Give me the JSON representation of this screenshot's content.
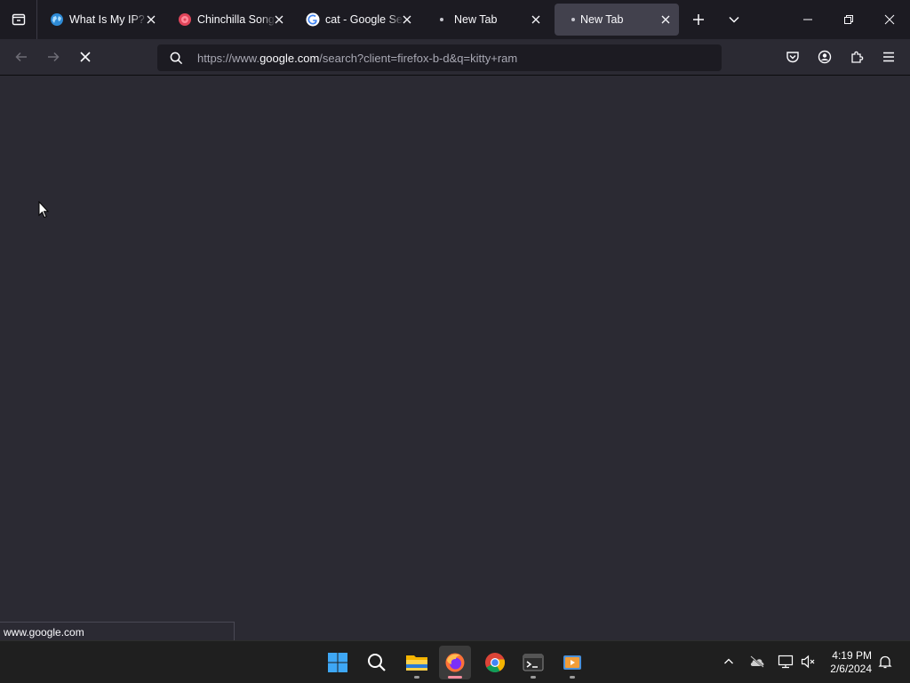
{
  "tabs": [
    {
      "title": "What Is My IP? Best",
      "favicon": "globe-icon",
      "active": false
    },
    {
      "title": "Chinchilla Songs",
      "favicon": "music-icon",
      "active": false
    },
    {
      "title": "cat - Google Search",
      "favicon": "google-icon",
      "active": false
    },
    {
      "title": "New Tab",
      "favicon": "loading-dot-icon",
      "active": false
    },
    {
      "title": "New Tab",
      "favicon": "loading-dot-icon",
      "active": true
    }
  ],
  "navbar": {
    "url_prefix": "https://www.",
    "url_host": "google.com",
    "url_suffix": "/search?client=firefox-b-d&q=kitty+ram"
  },
  "status": {
    "link": "www.google.com"
  },
  "clock": {
    "time": "4:19 PM",
    "date": "2/6/2024"
  },
  "colors": {
    "background": "#2b2a33",
    "tabbar": "#1c1b22",
    "active_tab": "#42414d",
    "taskbar": "#1f1f1f",
    "firefox_indicator": "#f28b9c"
  }
}
